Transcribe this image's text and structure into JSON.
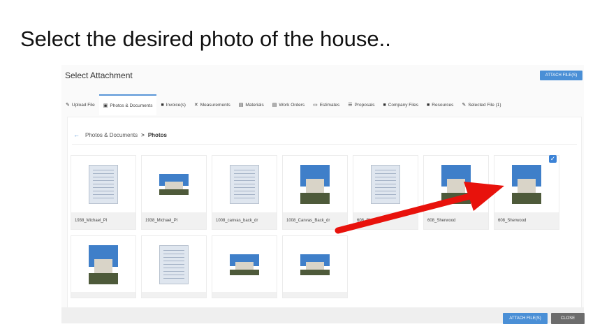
{
  "caption": "Select the desired photo of the house..",
  "dialog": {
    "title": "Select Attachment",
    "attach_top_label": "ATTACH FILE(S)",
    "attach_bottom_label": "ATTACH FILE(S)",
    "close_label": "CLOSE"
  },
  "tabs": [
    {
      "label": "Upload File",
      "icon": "paperclip-icon",
      "glyph": "✎"
    },
    {
      "label": "Photos & Documents",
      "icon": "image-icon",
      "glyph": "▣"
    },
    {
      "label": "Invoice(s)",
      "icon": "document-icon",
      "glyph": "■"
    },
    {
      "label": "Measurements",
      "icon": "ruler-icon",
      "glyph": "✕"
    },
    {
      "label": "Materials",
      "icon": "clipboard-icon",
      "glyph": "▤"
    },
    {
      "label": "Work Orders",
      "icon": "clipboard-icon",
      "glyph": "▤"
    },
    {
      "label": "Estimates",
      "icon": "card-icon",
      "glyph": "▭"
    },
    {
      "label": "Proposals",
      "icon": "list-icon",
      "glyph": "☰"
    },
    {
      "label": "Company Files",
      "icon": "folder-icon",
      "glyph": "■"
    },
    {
      "label": "Resources",
      "icon": "folder-icon",
      "glyph": "■"
    },
    {
      "label": "Selected File (1)",
      "icon": "paperclip-icon",
      "glyph": "✎"
    }
  ],
  "breadcrumb": {
    "parent": "Photos & Documents",
    "separator": ">",
    "current": "Photos"
  },
  "files_row1": [
    {
      "name": "1938_Michael_Pl",
      "kind": "doc"
    },
    {
      "name": "1938_Michael_Pl",
      "kind": "house-wide"
    },
    {
      "name": "1008_canvas_back_dr",
      "kind": "doc"
    },
    {
      "name": "1008_Canvas_Back_dr",
      "kind": "house"
    },
    {
      "name": "608_She",
      "kind": "doc"
    },
    {
      "name": "608_Sherwood",
      "kind": "house"
    },
    {
      "name": "608_Sherwood",
      "kind": "house",
      "selected": true
    }
  ],
  "files_row2": [
    {
      "name": "",
      "kind": "house"
    },
    {
      "name": "",
      "kind": "doc"
    },
    {
      "name": "",
      "kind": "house-wide"
    },
    {
      "name": "",
      "kind": "house-wide"
    }
  ],
  "colors": {
    "accent": "#4a8fd6",
    "arrow": "#e8120c"
  }
}
